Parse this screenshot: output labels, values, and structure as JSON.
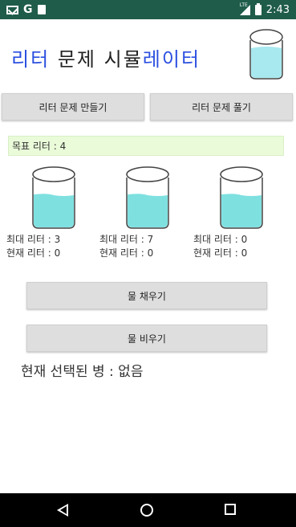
{
  "status_bar": {
    "icons": [
      "mail-icon",
      "google-icon",
      "sd-card-icon",
      "signal-icon",
      "battery-icon"
    ],
    "network_label": "LTE",
    "time": "2:43"
  },
  "header": {
    "title_part1": "리터",
    "title_part2": "문제",
    "title_part3": "시뮬",
    "title_part4": "레이터"
  },
  "buttons": {
    "make_problem": "리터 문제 만들기",
    "solve_problem": "리터 문제 풀기",
    "fill_water": "물 채우기",
    "empty_water": "물 비우기"
  },
  "target": {
    "label": "목표 리터 : 4"
  },
  "bottles": [
    {
      "max_label": "최대 리터 : 3",
      "current_label": "현재 리터 : 0"
    },
    {
      "max_label": "최대 리터 : 7",
      "current_label": "현재 리터 : 0"
    },
    {
      "max_label": "최대 리터 : 0",
      "current_label": "현재 리터 : 0"
    }
  ],
  "selected_bottle": {
    "label": "현재 선택된 병 : 없음"
  },
  "colors": {
    "status_bar": "#1f5c49",
    "water": "#7fe0e0",
    "target_bg": "#eafbd9"
  }
}
